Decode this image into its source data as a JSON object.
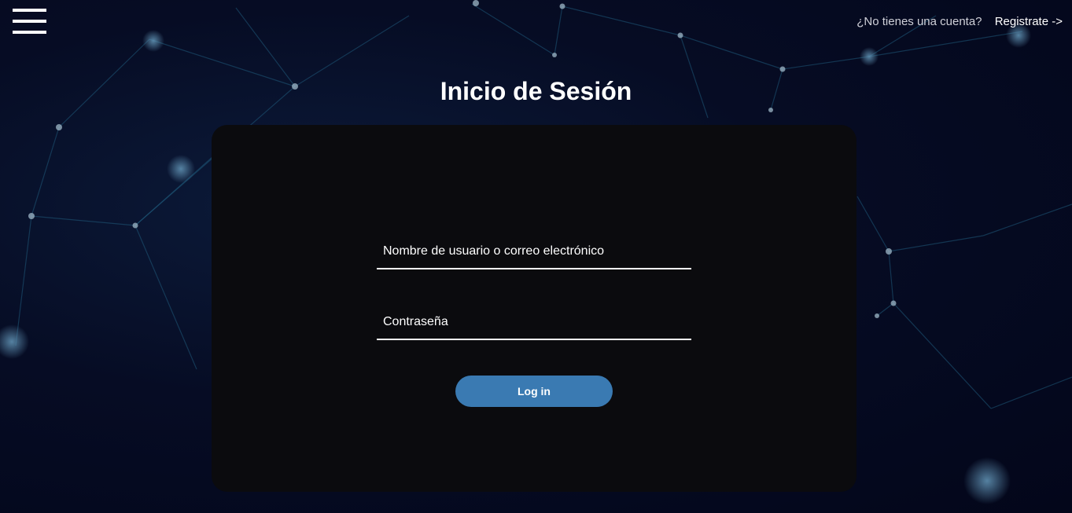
{
  "header": {
    "menu_icon": "hamburger-menu-icon",
    "no_account_text": "¿No tienes una cuenta?",
    "register_link": "Registrate ->"
  },
  "main": {
    "title": "Inicio de Sesión"
  },
  "form": {
    "username_placeholder": "Nombre de usuario o correo electrónico",
    "username_value": "",
    "password_placeholder": "Contraseña",
    "password_value": "",
    "submit_label": "Log in"
  },
  "colors": {
    "background": "#050a1e",
    "card": "#0b0b0e",
    "button": "#3a7ab2",
    "text": "#ffffff"
  }
}
